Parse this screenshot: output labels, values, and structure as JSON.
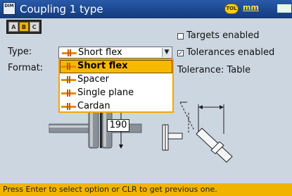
{
  "window": {
    "title": "Coupling 1 type",
    "tolerance_badge": "TOL",
    "units": "mm",
    "app_icon_text": "DIM"
  },
  "tabs": [
    {
      "label": "A"
    },
    {
      "label": "B"
    },
    {
      "label": "C"
    }
  ],
  "form": {
    "type_label": "Type:",
    "type_value": "Short flex",
    "format_label": "Format:",
    "targets_enabled_label": "Targets enabled",
    "targets_enabled_checked": false,
    "tolerances_enabled_label": "Tolerances enabled",
    "tolerances_enabled_checked": true,
    "tolerance_label": "Tolerance: Table"
  },
  "dropdown": {
    "options": [
      {
        "label": "Short flex",
        "icon": "short-flex-coupling-icon",
        "selected": true
      },
      {
        "label": "Spacer",
        "icon": "spacer-coupling-icon",
        "selected": false
      },
      {
        "label": "Single plane",
        "icon": "single-plane-coupling-icon",
        "selected": false
      },
      {
        "label": "Cardan",
        "icon": "cardan-coupling-icon",
        "selected": false
      }
    ]
  },
  "diagram": {
    "dimension_value": "190"
  },
  "footer": {
    "hint": "Press Enter to select option or CLR to get previous one."
  },
  "colors": {
    "titlebar": "#1b4890",
    "background": "#ccd6e0",
    "highlight": "#f7b800",
    "footer": "#f2b300",
    "accent_orange": "#e58a14"
  }
}
